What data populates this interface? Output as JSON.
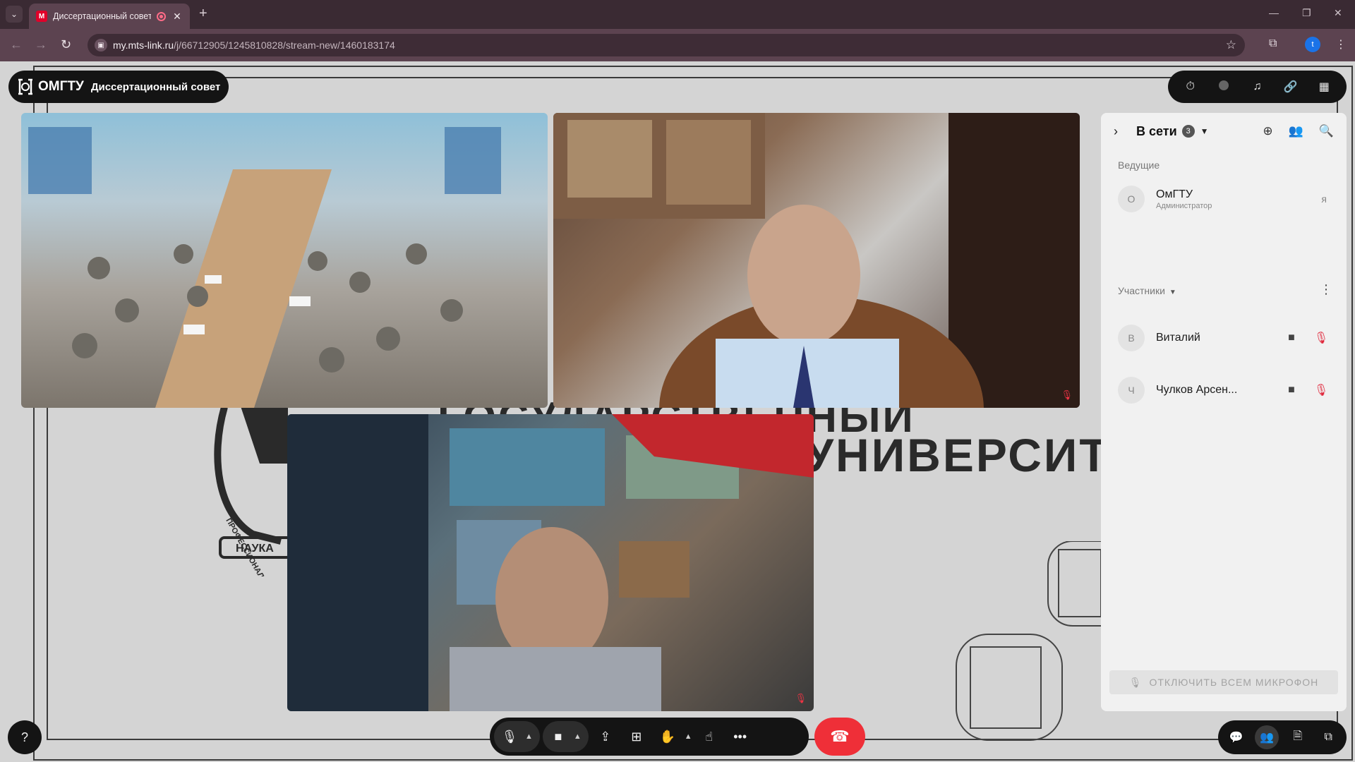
{
  "browser": {
    "tab_title": "Диссертационный совет",
    "tab_favicon": "M",
    "tab_close": "✕",
    "new_tab": "+",
    "url_domain": "my.mts-link.ru",
    "url_path": "/j/66712905/1245810828/stream-new/1460183174",
    "profile_initial": "t",
    "icons": [
      "tab-search-icon",
      "back-icon",
      "forward-icon",
      "reload-icon",
      "star-icon",
      "extensions-icon",
      "menu-icon",
      "minimize-icon",
      "restore-icon",
      "close-icon"
    ]
  },
  "app": {
    "brand_logo": "ОМГТУ",
    "brand_title": "Диссертационный совет",
    "top_icons": [
      "timer-icon",
      "record-icon",
      "sound-icon",
      "link-icon",
      "apps-grid-icon"
    ]
  },
  "slide": {
    "line1": "ГОСУДАРСТВЕННЫЙ",
    "line2": "УНИВЕРСИТЕТ",
    "emblem_text_1": "ПРОФЕССИОНАЛИЗМ",
    "emblem_text_2": "НАУКА"
  },
  "panel": {
    "title": "В сети",
    "count": "3",
    "hosts_label": "Ведущие",
    "host": {
      "initial": "О",
      "name": "ОмГТУ",
      "role": "Администратор",
      "me": "я"
    },
    "participants_label": "Участники",
    "participants": [
      {
        "initial": "В",
        "name": "Виталий"
      },
      {
        "initial": "Ч",
        "name": "Чулков Арсен..."
      }
    ],
    "mute_all": "ОТКЛЮЧИТЬ ВСЕМ МИКРОФОН"
  },
  "controls": {
    "help": "?",
    "bottom_icons": [
      "microphone-icon",
      "camera-icon",
      "screen-share-icon",
      "layout-add-icon",
      "raise-hand-icon",
      "reaction-icon",
      "more-icon",
      "hangup-icon"
    ],
    "right_icons": [
      "chat-icon",
      "participants-icon",
      "files-icon",
      "apps-icon"
    ]
  },
  "colors": {
    "hangup": "#ef2f38",
    "mic_muted": "#e0283c",
    "browser_bar": "#5c4350"
  }
}
